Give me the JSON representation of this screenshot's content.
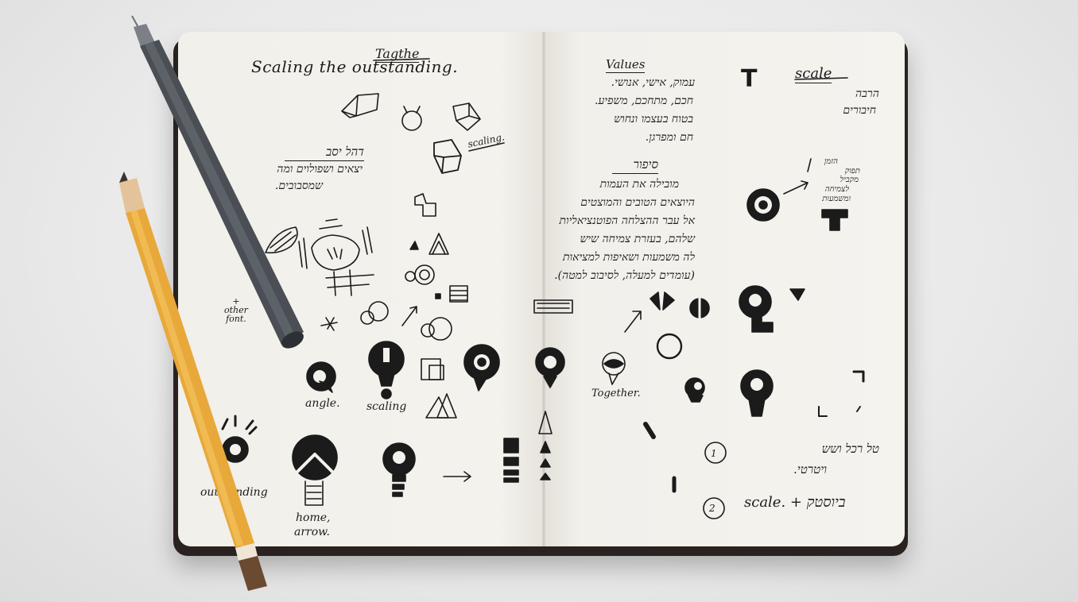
{
  "page": {
    "top_heading": "Tagthe",
    "tagline": "Scaling the outstanding.",
    "label_scaling_small": "scaling.",
    "left_hebrew_heading": "דהל יסב",
    "left_hebrew_lines": [
      "יצאים ושפולוים ומה",
      "שמסבובים."
    ],
    "label_other_font": "+\nother\nfont.",
    "label_angle": "angle.",
    "label_scaling": "scaling",
    "label_outstanding": "outstanding",
    "label_home_arrow_1": "home,",
    "label_home_arrow_2": "arrow.",
    "values_heading": "Values",
    "values_lines": [
      "עמוק, אישי, אנושי.",
      "חכם, מתחכם, משפיע.",
      "בטוח בעצמו ונחוש",
      "חם ומפרגן."
    ],
    "story_heading": "סיפור",
    "story_lines": [
      "מובילה את העמות",
      "היוצאים הטובים והמוצטים",
      "אל עבר ההצלחה הפוטנציאליות",
      "שלהם, בעזרת צמיחה שיש",
      "לה משמעות ושאיפות למציאות",
      "(עומדים למעלה, לסיבוב למטה)."
    ],
    "label_together": "Together.",
    "scale_heading": "scale",
    "scale_lines": [
      "הרבה",
      "חיבורים"
    ],
    "scale_note_lines": [
      "הזמן",
      "תפוק",
      "מקביל",
      "לצמיחה",
      "ומשמעות"
    ],
    "label_T": "T",
    "option_1_num": "1",
    "option_1_lines": [
      "טל רכל ושש",
      "ויטרטי."
    ],
    "option_2_num": "2",
    "option_2_text": "scale. + ביוסטק"
  },
  "colors": {
    "ink": "#1b1b1b",
    "paper": "#f3f1ec",
    "cover": "#2a2220",
    "pencil_body": "#e8a83a",
    "pen_body": "#4a4e55",
    "background": "#e9e9e9"
  }
}
